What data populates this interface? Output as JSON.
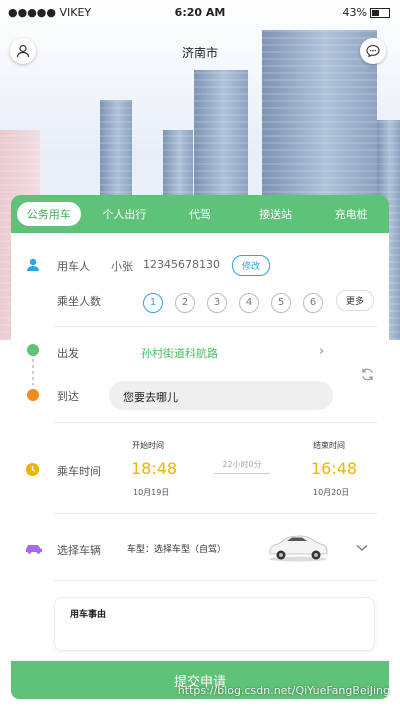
{
  "status_bar": {
    "carrier": "●●●●● VIKEY",
    "time": "6:20 AM",
    "battery": "43%"
  },
  "header": {
    "title": "济南市"
  },
  "tabs": [
    "公务用车",
    "个人出行",
    "代驾",
    "接送站",
    "充电桩"
  ],
  "user": {
    "label": "用车人",
    "name": "小张",
    "phone": "12345678130",
    "edit_label": "修改"
  },
  "passengers": {
    "label": "乘坐人数",
    "options": [
      "1",
      "2",
      "3",
      "4",
      "5",
      "6"
    ],
    "more_label": "更多"
  },
  "route": {
    "from_label": "出发",
    "from_value": "孙村街道科航路",
    "to_label": "到达",
    "to_placeholder": "您要去哪儿"
  },
  "time": {
    "label": "乘车时间",
    "start_label": "开始时间",
    "start_time": "18:48",
    "start_date": "10月19日",
    "duration": "22小时0分",
    "end_label": "结束时间",
    "end_time": "16:48",
    "end_date": "10月20日"
  },
  "vehicle": {
    "label": "选择车辆",
    "type_text": "车型：选择车型（自驾）"
  },
  "reason": {
    "label": "用车事由"
  },
  "submit_label": "提交申请",
  "watermark": "https://blog.csdn.net/QiYueFangBeiJing",
  "colors": {
    "brand_green": "#5ec278",
    "accent_blue": "#2aa6e0",
    "time_yellow": "#f0b400"
  }
}
